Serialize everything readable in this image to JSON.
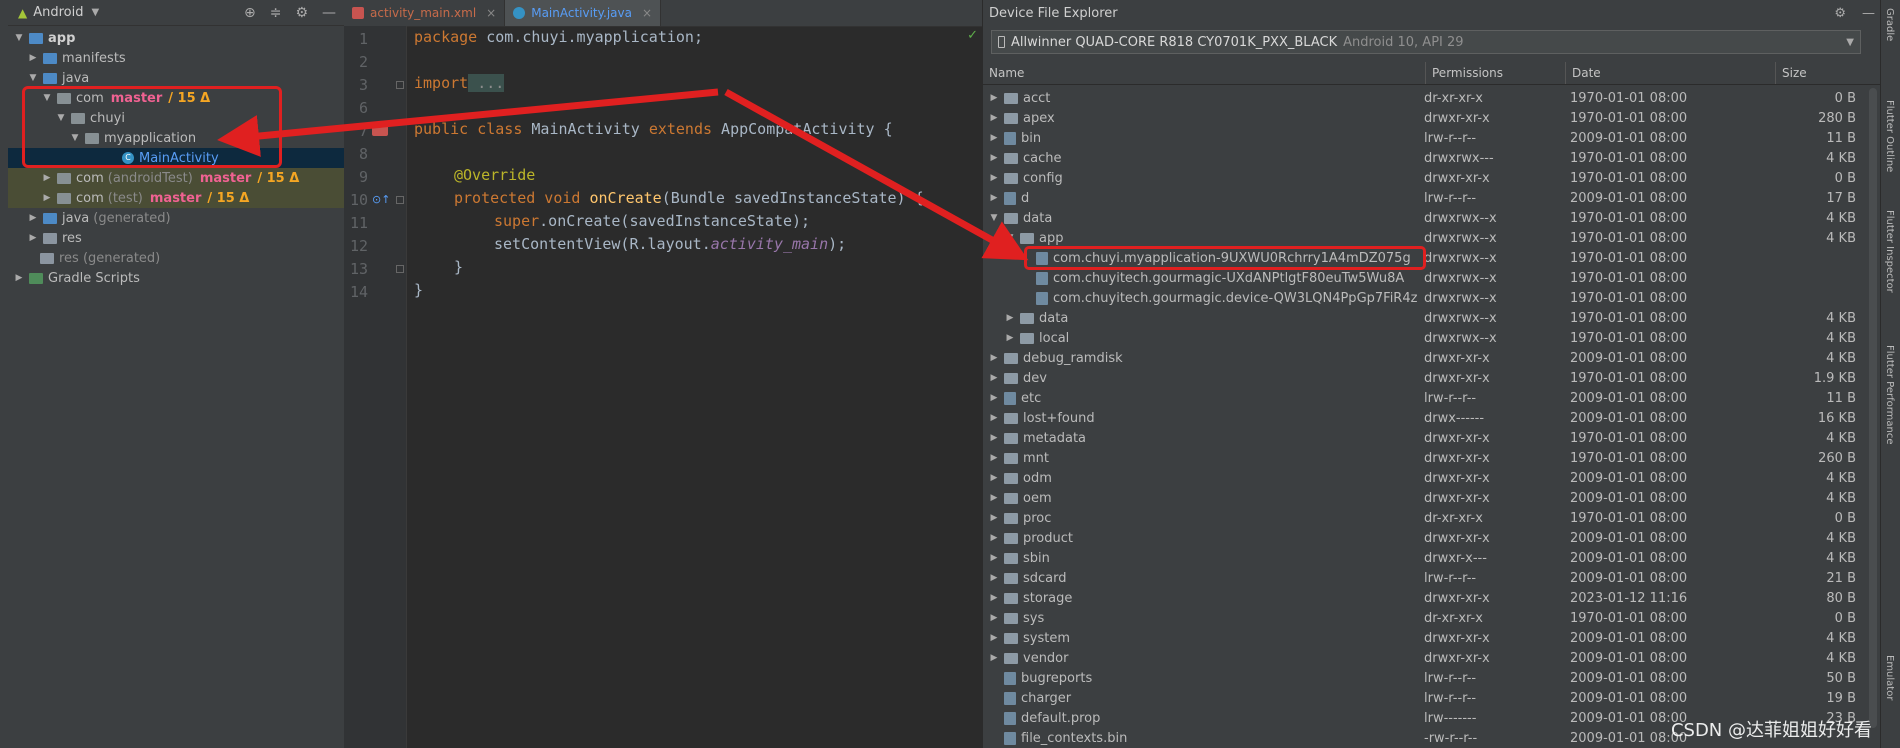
{
  "project_panel": {
    "title": "Android",
    "tree": [
      {
        "label": "app",
        "bold": true
      },
      {
        "label": "manifests"
      },
      {
        "label": "java"
      },
      {
        "label": "com",
        "branch": "master",
        "delta": "/ 15 Δ"
      },
      {
        "label": "chuyi"
      },
      {
        "label": "myapplication"
      },
      {
        "label": "MainActivity"
      },
      {
        "label": "com",
        "suffix": "(androidTest)",
        "branch": "master",
        "delta": "/ 15 Δ"
      },
      {
        "label": "com",
        "suffix": "(test)",
        "branch": "master",
        "delta": "/ 15 Δ"
      },
      {
        "label": "java",
        "suffix": "(generated)"
      },
      {
        "label": "res"
      },
      {
        "label": "res (generated)"
      },
      {
        "label": "Gradle Scripts"
      }
    ]
  },
  "editor": {
    "tabs": [
      {
        "label": "activity_main.xml",
        "close": "×"
      },
      {
        "label": "MainActivity.java",
        "close": "×"
      }
    ],
    "line_numbers": [
      "1",
      "2",
      "3",
      "6",
      "7",
      "8",
      "9",
      "10",
      "11",
      "12",
      "13",
      "14"
    ],
    "code": {
      "l1_kw": "package",
      "l1_rest": " com.chuyi.myapplication;",
      "l3_kw": "import",
      "l3_rest": " ...",
      "l7_kw": "public class",
      "l7_mid": " MainActivity ",
      "l7_kw2": "extends",
      "l7_rest": " AppCompatActivity {",
      "l9": "@Override",
      "l10_kw": "protected void",
      "l10_fn": " onCreate",
      "l10_rest": "(Bundle savedInstanceState) {",
      "l11_kw": "super",
      "l11_rest": ".onCreate(savedInstanceState);",
      "l12_a": "setContentView(R.layout.",
      "l12_it": "activity_main",
      "l12_b": ");",
      "l13": "}",
      "l14": "}"
    }
  },
  "device_file_explorer": {
    "title": "Device File Explorer",
    "device_name": "Allwinner QUAD-CORE R818 CY0701K_PXX_BLACK",
    "device_api": "Android 10, API 29",
    "columns": [
      "Name",
      "Permissions",
      "Date",
      "Size"
    ],
    "rows": [
      {
        "name": "acct",
        "perm": "dr-xr-xr-x",
        "date": "1970-01-01 08:00",
        "size": "0 B"
      },
      {
        "name": "apex",
        "perm": "drwxr-xr-x",
        "date": "1970-01-01 08:00",
        "size": "280 B"
      },
      {
        "name": "bin",
        "perm": "lrw-r--r--",
        "date": "2009-01-01 08:00",
        "size": "11 B"
      },
      {
        "name": "cache",
        "perm": "drwxrwx---",
        "date": "1970-01-01 08:00",
        "size": "4 KB"
      },
      {
        "name": "config",
        "perm": "drwxr-xr-x",
        "date": "1970-01-01 08:00",
        "size": "0 B"
      },
      {
        "name": "d",
        "perm": "lrw-r--r--",
        "date": "2009-01-01 08:00",
        "size": "17 B"
      },
      {
        "name": "data",
        "perm": "drwxrwx--x",
        "date": "1970-01-01 08:00",
        "size": "4 KB"
      },
      {
        "name": "app",
        "perm": "drwxrwx--x",
        "date": "1970-01-01 08:00",
        "size": "4 KB"
      },
      {
        "name": "com.chuyi.myapplication-9UXWU0Rchrry1A4mDZ075g",
        "perm": "drwxrwx--x",
        "date": "1970-01-01 08:00",
        "size": ""
      },
      {
        "name": "com.chuyitech.gourmagic-UXdANPtlgtF80euTw5Wu8A",
        "perm": "drwxrwx--x",
        "date": "1970-01-01 08:00",
        "size": ""
      },
      {
        "name": "com.chuyitech.gourmagic.device-QW3LQN4PpGp7FiR4z",
        "perm": "drwxrwx--x",
        "date": "1970-01-01 08:00",
        "size": ""
      },
      {
        "name": "data",
        "perm": "drwxrwx--x",
        "date": "1970-01-01 08:00",
        "size": "4 KB"
      },
      {
        "name": "local",
        "perm": "drwxrwx--x",
        "date": "1970-01-01 08:00",
        "size": "4 KB"
      },
      {
        "name": "debug_ramdisk",
        "perm": "drwxr-xr-x",
        "date": "2009-01-01 08:00",
        "size": "4 KB"
      },
      {
        "name": "dev",
        "perm": "drwxr-xr-x",
        "date": "1970-01-01 08:00",
        "size": "1.9 KB"
      },
      {
        "name": "etc",
        "perm": "lrw-r--r--",
        "date": "2009-01-01 08:00",
        "size": "11 B"
      },
      {
        "name": "lost+found",
        "perm": "drwx------",
        "date": "2009-01-01 08:00",
        "size": "16 KB"
      },
      {
        "name": "metadata",
        "perm": "drwxr-xr-x",
        "date": "1970-01-01 08:00",
        "size": "4 KB"
      },
      {
        "name": "mnt",
        "perm": "drwxr-xr-x",
        "date": "1970-01-01 08:00",
        "size": "260 B"
      },
      {
        "name": "odm",
        "perm": "drwxr-xr-x",
        "date": "2009-01-01 08:00",
        "size": "4 KB"
      },
      {
        "name": "oem",
        "perm": "drwxr-xr-x",
        "date": "2009-01-01 08:00",
        "size": "4 KB"
      },
      {
        "name": "proc",
        "perm": "dr-xr-xr-x",
        "date": "1970-01-01 08:00",
        "size": "0 B"
      },
      {
        "name": "product",
        "perm": "drwxr-xr-x",
        "date": "2009-01-01 08:00",
        "size": "4 KB"
      },
      {
        "name": "sbin",
        "perm": "drwxr-x---",
        "date": "2009-01-01 08:00",
        "size": "4 KB"
      },
      {
        "name": "sdcard",
        "perm": "lrw-r--r--",
        "date": "2009-01-01 08:00",
        "size": "21 B"
      },
      {
        "name": "storage",
        "perm": "drwxr-xr-x",
        "date": "2023-01-12 11:16",
        "size": "80 B"
      },
      {
        "name": "sys",
        "perm": "dr-xr-xr-x",
        "date": "1970-01-01 08:00",
        "size": "0 B"
      },
      {
        "name": "system",
        "perm": "drwxr-xr-x",
        "date": "2009-01-01 08:00",
        "size": "4 KB"
      },
      {
        "name": "vendor",
        "perm": "drwxr-xr-x",
        "date": "2009-01-01 08:00",
        "size": "4 KB"
      },
      {
        "name": "bugreports",
        "perm": "lrw-r--r--",
        "date": "2009-01-01 08:00",
        "size": "50 B"
      },
      {
        "name": "charger",
        "perm": "lrw-r--r--",
        "date": "2009-01-01 08:00",
        "size": "19 B"
      },
      {
        "name": "default.prop",
        "perm": "lrw-------",
        "date": "2009-01-01 08:00",
        "size": "23 B"
      },
      {
        "name": "file_contexts.bin",
        "perm": "-rw-r--r--",
        "date": "2009-01-01 08:00",
        "size": ""
      }
    ]
  },
  "right_stripe": {
    "labels": [
      "Gradle",
      "Flutter Outline",
      "Flutter Inspector",
      "Flutter Performance",
      "Emulator"
    ]
  },
  "watermark": "CSDN @达菲姐姐好好看",
  "colors": {
    "highlight": "#e02020",
    "branch": "#f06292",
    "delta": "#f5a623"
  }
}
